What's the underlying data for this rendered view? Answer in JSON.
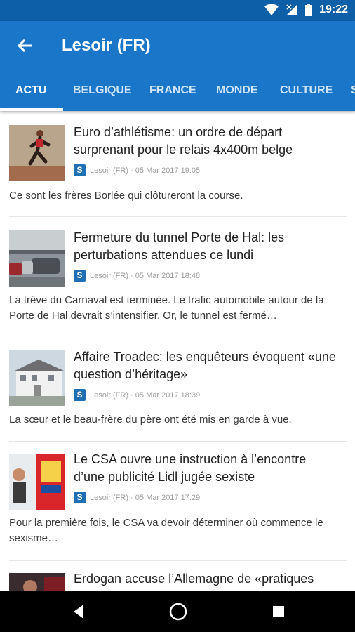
{
  "status_bar": {
    "time": "19:22",
    "icons": [
      "wifi-icon",
      "signal-off-icon",
      "battery-icon"
    ]
  },
  "app_bar": {
    "title": "Lesoir (FR)",
    "back_icon": "arrow-left-icon"
  },
  "tabs": [
    {
      "label": "ACTU",
      "active": true
    },
    {
      "label": "BELGIQUE",
      "active": false
    },
    {
      "label": "FRANCE",
      "active": false
    },
    {
      "label": "MONDE",
      "active": false
    },
    {
      "label": "CULTURE",
      "active": false
    },
    {
      "label": "S",
      "active": false
    }
  ],
  "articles": [
    {
      "headline": "Euro d’athlétisme: un ordre de départ surprenant pour le relais 4x400m belge",
      "source_icon": "S",
      "meta": "Lesoir (FR) · 05 Mar 2017 19:05",
      "snippet": "Ce sont les frères Borlée qui clôtureront la course."
    },
    {
      "headline": "Fermeture du tunnel Porte de Hal: les perturbations attendues ce lundi",
      "source_icon": "S",
      "meta": "Lesoir (FR) · 05 Mar 2017 18:48",
      "snippet": "La trêve du Carnaval est terminée. Le trafic automobile autour de la Porte de Hal devrait s’intensifier. Or, le tunnel est fermé…"
    },
    {
      "headline": "Affaire Troadec: les enquêteurs évoquent «une question d’héritage»",
      "source_icon": "S",
      "meta": "Lesoir (FR) · 05 Mar 2017 18:39",
      "snippet": "La sœur et le beau-frère du père ont été mis en garde à vue."
    },
    {
      "headline": "Le CSA ouvre une instruction à l’encontre d’une publicité Lidl jugée sexiste",
      "source_icon": "S",
      "meta": "Lesoir (FR) · 05 Mar 2017 17:29",
      "snippet": "Pour la première fois, le CSA va devoir déterminer où commence le sexisme…"
    },
    {
      "headline": "Erdogan accuse l’Allemagne de «pratiques",
      "source_icon": "",
      "meta": "",
      "snippet": ""
    }
  ],
  "nav_bar": {
    "icons": [
      "back-triangle-icon",
      "home-circle-icon",
      "recents-square-icon"
    ]
  }
}
